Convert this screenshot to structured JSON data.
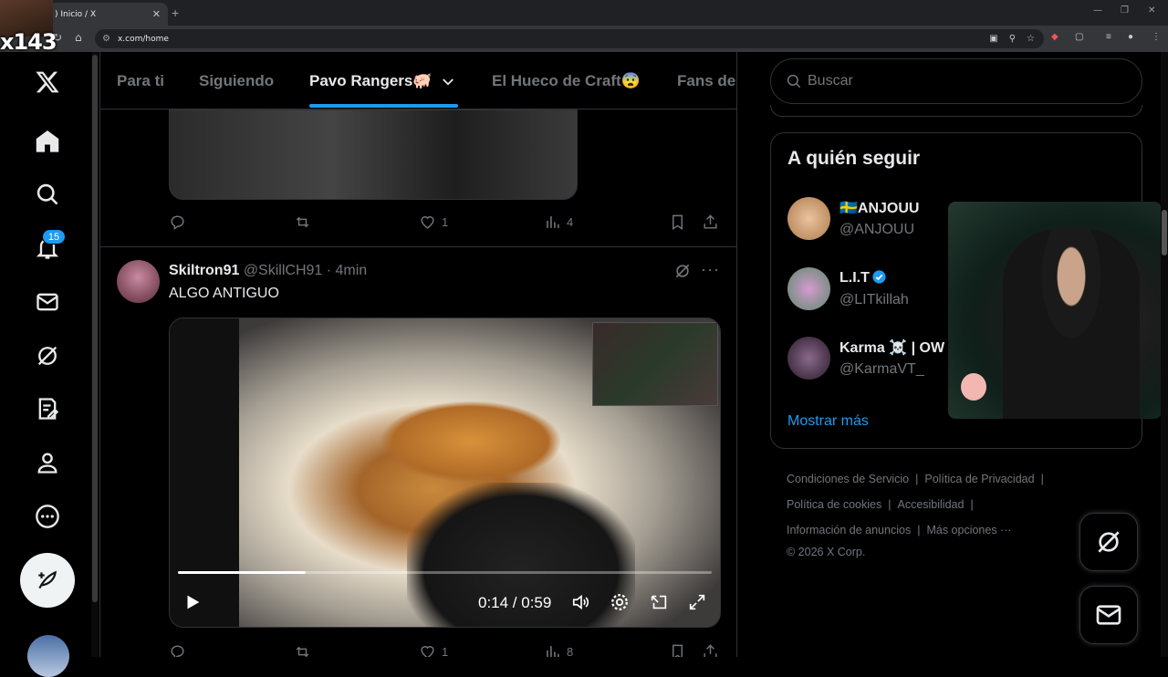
{
  "browser": {
    "tab_title": ") Inicio / X",
    "url": "x.com/home"
  },
  "overlay": {
    "counter": "x143"
  },
  "sidebar": {
    "notification_count": "15",
    "icons": [
      "x-logo-icon",
      "home-icon",
      "search-icon",
      "bell-icon",
      "mail-icon",
      "grok-icon",
      "list-icon",
      "profile-icon",
      "more-icon"
    ]
  },
  "timeline": {
    "tabs": [
      {
        "label": "Para ti"
      },
      {
        "label": "Siguiendo"
      },
      {
        "label": "Pavo Rangers🐖"
      },
      {
        "label": "El Hueco de Craft😨"
      },
      {
        "label": "Fans de"
      }
    ],
    "prev_post": {
      "likes": "1",
      "views": "4"
    },
    "post": {
      "name": "Skiltron91",
      "handle": "@SkillCH91",
      "time": "· 4min",
      "text": "ALGO ANTIGUO",
      "video_time": "0:14 / 0:59",
      "progress": 0.24,
      "likes": "1",
      "views": "8"
    }
  },
  "right": {
    "search_placeholder": "Buscar",
    "who_to_follow_title": "A quién seguir",
    "suggestions": [
      {
        "name": "🇸🇪ANJOUU",
        "handle": "@ANJOUU",
        "color": "#d9a77a",
        "verified": false
      },
      {
        "name": "L.I.T",
        "handle": "@LITkillah",
        "color": "#c27fb8",
        "verified": true
      },
      {
        "name": "Karma ☠️ | OW",
        "handle": "@KarmaVT_",
        "color": "#4a3548",
        "verified": false
      }
    ],
    "show_more": "Mostrar más",
    "footer_lines": [
      [
        "Condiciones de Servicio",
        "Política de Privacidad"
      ],
      [
        "Política de cookies",
        "Accesibilidad"
      ],
      [
        "Información de anuncios",
        "Más opciones ···"
      ]
    ],
    "copyright": "© 2026 X Corp."
  },
  "colors": {
    "accent": "#1d9bf0",
    "border": "#2f3336",
    "muted": "#71767b"
  }
}
